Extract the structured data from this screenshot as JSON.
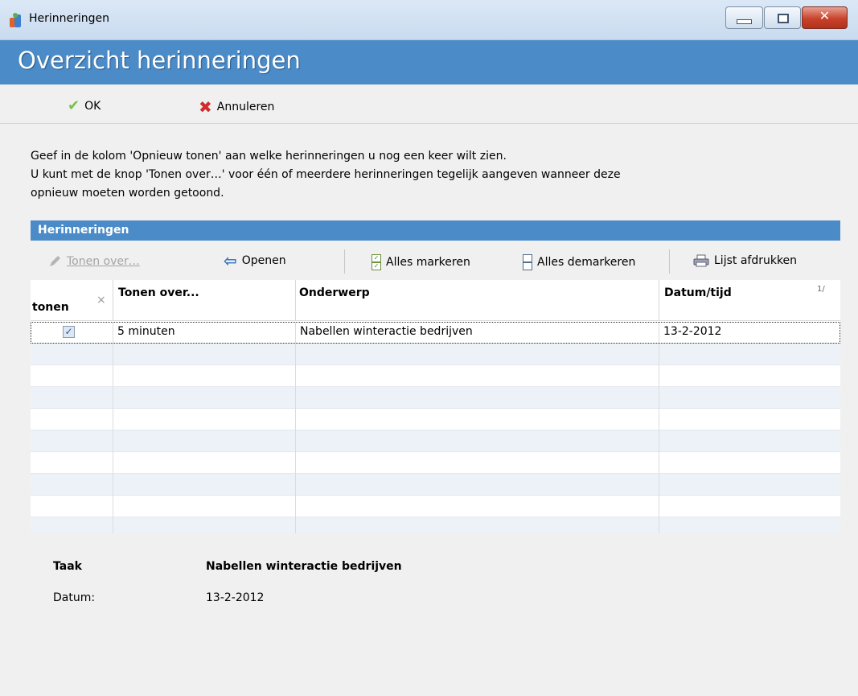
{
  "window": {
    "title": "Herinneringen"
  },
  "banner": {
    "title": "Overzicht herinneringen"
  },
  "toolbar": {
    "ok_label": "OK",
    "cancel_label": "Annuleren"
  },
  "intro": [
    "Geef in de kolom 'Opnieuw tonen' aan welke herinneringen u nog een keer wilt zien.",
    "U kunt met de knop 'Tonen over…' voor één of meerdere herinneringen tegelijk aangeven wanneer deze",
    "opnieuw moeten worden getoond."
  ],
  "section": {
    "title": "Herinneringen"
  },
  "gridbar": {
    "tonen_over": "Tonen over…",
    "openen": "Openen",
    "alles_markeren": "Alles markeren",
    "alles_demarkeren": "Alles demarkeren",
    "lijst_afdrukken": "Lijst afdrukken"
  },
  "columns": {
    "tonen": "tonen",
    "tonen_over": "Tonen over...",
    "onderwerp": "Onderwerp",
    "datum": "Datum/tijd",
    "sort_indicator": "1/"
  },
  "rows": [
    {
      "checked": true,
      "tonen_over": "5 minuten",
      "onderwerp": "Nabellen winteractie bedrijven",
      "datum": "13-2-2012"
    }
  ],
  "details": {
    "taak_label": "Taak",
    "taak_value": "Nabellen winteractie bedrijven",
    "datum_label": "Datum:",
    "datum_value": "13-2-2012"
  },
  "colors": {
    "accent": "#4a8bc8",
    "close": "#c7422b"
  }
}
